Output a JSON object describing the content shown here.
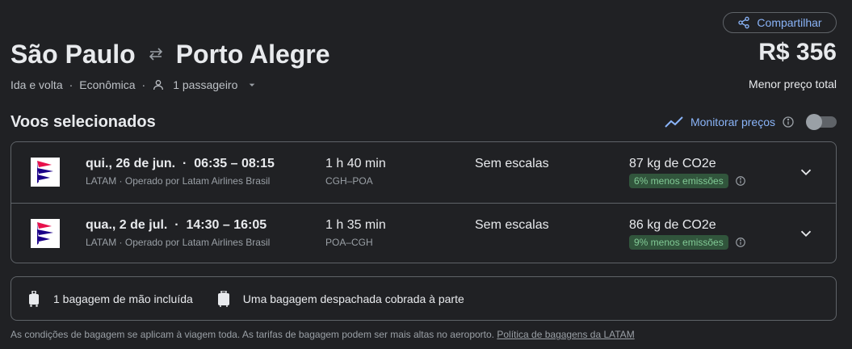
{
  "header": {
    "share_label": "Compartilhar",
    "origin": "São Paulo",
    "destination": "Porto Alegre",
    "price": "R$ 356",
    "price_label": "Menor preço total",
    "trip_type": "Ida e volta",
    "cabin": "Econômica",
    "passengers": "1 passageiro"
  },
  "section": {
    "title": "Voos selecionados",
    "monitor_label": "Monitorar preços"
  },
  "flights": [
    {
      "date": "qui., 26 de jun.",
      "times": "06:35 – 08:15",
      "airline_line": "LATAM · Operado por Latam Airlines Brasil",
      "duration": "1 h 40 min",
      "route": "CGH–POA",
      "stops": "Sem escalas",
      "co2": "87 kg de CO2e",
      "emissions_badge": "6% menos emissões"
    },
    {
      "date": "qua., 2 de jul.",
      "times": "14:30 – 16:05",
      "airline_line": "LATAM · Operado por Latam Airlines Brasil",
      "duration": "1 h 35 min",
      "route": "POA–CGH",
      "stops": "Sem escalas",
      "co2": "86 kg de CO2e",
      "emissions_badge": "9% menos emissões"
    }
  ],
  "bags": {
    "carry_on": "1 bagagem de mão incluída",
    "checked": "Uma bagagem despachada cobrada à parte"
  },
  "footnote": {
    "text": "As condições de bagagem se aplicam à viagem toda. As tarifas de bagagem podem ser mais altas no aeroporto.",
    "link": "Política de bagagens da LATAM"
  },
  "icons": {
    "share": "share-icon",
    "swap": "swap-arrows-icon",
    "person": "person-icon",
    "dropdown": "chevron-down-icon",
    "trend": "trending-icon",
    "info": "info-icon",
    "airline": "latam-logo-icon",
    "expand": "chevron-down-icon",
    "carry_on": "carry-on-bag-icon",
    "checked_bag": "checked-bag-icon"
  },
  "colors": {
    "background": "#202124",
    "link": "#8ab4f8",
    "badge_bg": "#31553c",
    "badge_text": "#81c995"
  },
  "monitor_toggle_on": false
}
